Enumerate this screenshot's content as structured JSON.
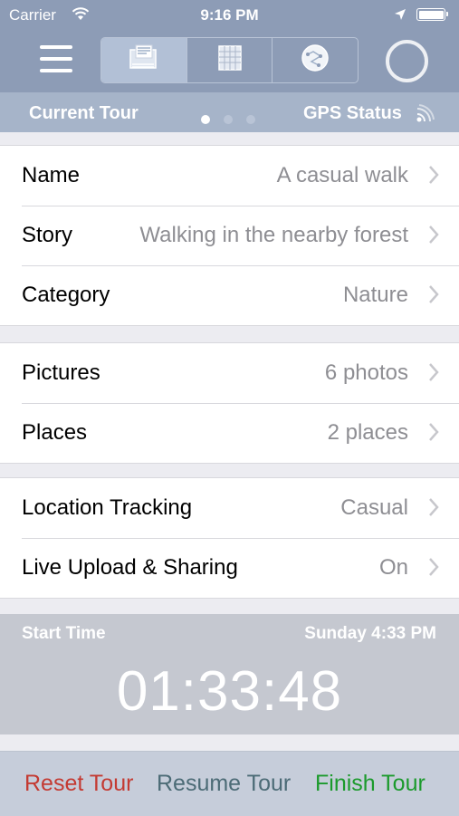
{
  "status_bar": {
    "carrier": "Carrier",
    "time": "9:16 PM"
  },
  "header": {
    "current_label": "Current Tour",
    "gps_label": "GPS Status",
    "page_dots": 3,
    "active_dot": 0
  },
  "tour": {
    "name": {
      "label": "Name",
      "value": "A casual walk"
    },
    "story": {
      "label": "Story",
      "value": "Walking in the nearby forest"
    },
    "category": {
      "label": "Category",
      "value": "Nature"
    },
    "pictures": {
      "label": "Pictures",
      "value": "6 photos"
    },
    "places": {
      "label": "Places",
      "value": "2 places"
    },
    "tracking": {
      "label": "Location Tracking",
      "value": "Casual"
    },
    "sharing": {
      "label": "Live Upload & Sharing",
      "value": "On"
    }
  },
  "timer": {
    "start_label": "Start Time",
    "start_value": "Sunday 4:33 PM",
    "elapsed": "01:33:48"
  },
  "toolbar": {
    "reset_label": "Reset Tour",
    "resume_label": "Resume Tour",
    "finish_label": "Finish Tour"
  },
  "icons": {
    "menu": "hamburger-menu-icon",
    "seg_tour": "tour-details-icon",
    "seg_grid": "grid-icon",
    "seg_map": "route-map-icon",
    "record": "record-ring-icon",
    "gps": "gps-signal-icon",
    "chevron": "chevron-right-icon"
  },
  "colors": {
    "header": "#8d9cb6",
    "subheader": "#a6b4c9",
    "reset": "#c43a32",
    "resume": "#4c6b76",
    "finish": "#1b9a2c"
  }
}
